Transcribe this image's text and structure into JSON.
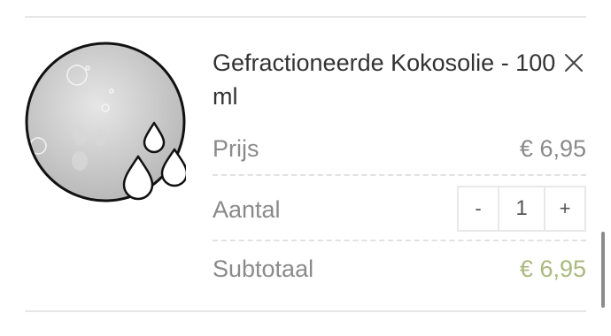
{
  "product": {
    "title": "Gefractioneerde Kokosolie - 100 ml",
    "image_icon": "oil-droplets-image",
    "remove_icon": "close-icon"
  },
  "rows": {
    "price_label": "Prijs",
    "price_value": "€ 6,95",
    "quantity_label": "Aantal",
    "decrement_label": "-",
    "quantity_value": "1",
    "increment_label": "+",
    "subtotal_label": "Subtotaal",
    "subtotal_value": "€ 6,95"
  },
  "colors": {
    "accent_subtotal": "#a9b97e",
    "muted_text": "#8a8a8a",
    "divider": "#e6e6e6"
  }
}
